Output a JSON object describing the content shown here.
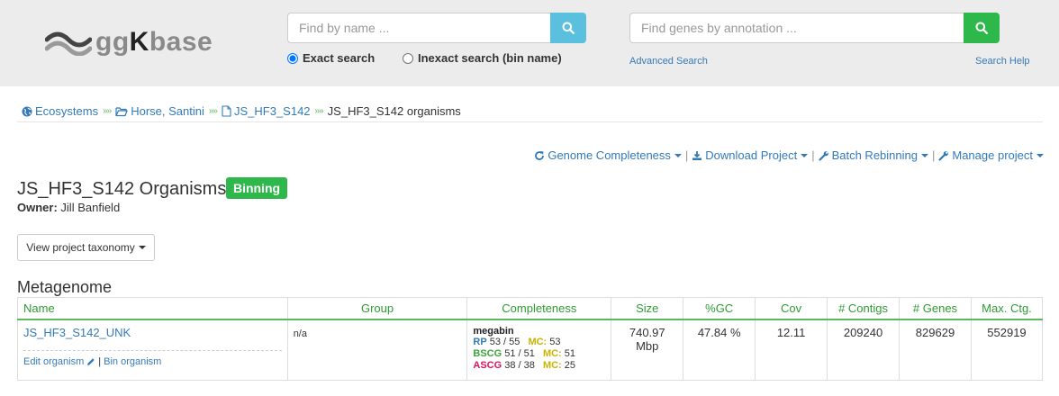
{
  "header": {
    "logo_prefix": "gg",
    "logo_k": "K",
    "logo_suffix": "base",
    "name_search": {
      "placeholder": "Find by name ..."
    },
    "annotation_search": {
      "placeholder": "Find genes by annotation ..."
    },
    "exact_label": "Exact search",
    "inexact_label": "Inexact search (bin name)",
    "exact_selected": true,
    "advanced_search": "Advanced Search",
    "search_help": "Search Help"
  },
  "breadcrumb": {
    "items": [
      "Ecosystems",
      "Horse, Santini",
      "JS_HF3_S142"
    ],
    "separator": "»»",
    "current": "JS_HF3_S142 organisms"
  },
  "actions": {
    "genome_completeness": "Genome Completeness",
    "download_project": "Download Project",
    "batch_rebinning": "Batch Rebinning",
    "manage_project": "Manage project"
  },
  "page": {
    "title": "JS_HF3_S142 Organisms",
    "badge": "Binning",
    "owner_label": "Owner:",
    "owner_name": "Jill Banfield",
    "taxonomy_button": "View project taxonomy"
  },
  "section": {
    "title": "Metagenome"
  },
  "table": {
    "columns": [
      "Name",
      "Group",
      "Completeness",
      "Size",
      "%GC",
      "Cov",
      "# Contigs",
      "# Genes",
      "Max. Ctg."
    ],
    "row": {
      "name": "JS_HF3_S142_UNK",
      "edit_link": "Edit organism",
      "bin_link": "Bin organism",
      "group": "n/a",
      "completeness": {
        "title": "megabin",
        "rp_label": "RP",
        "rp_value": "53 / 55",
        "rp_mc_label": "MC:",
        "rp_mc": "53",
        "bscg_label": "BSCG",
        "bscg_value": "51 / 51",
        "bscg_mc_label": "MC:",
        "bscg_mc": "51",
        "ascg_label": "ASCG",
        "ascg_value": "38 / 38",
        "ascg_mc_label": "MC:",
        "ascg_mc": "25"
      },
      "size_value": "740.97",
      "size_unit": "Mbp",
      "gc": "47.84 %",
      "cov": "12.11",
      "contigs": "209240",
      "genes": "829629",
      "max_ctg": "552919"
    }
  },
  "colors": {
    "brand_green": "#2eb84b",
    "link_blue": "#337ab7",
    "info_button": "#5bc0de",
    "header_bg": "#ececec"
  }
}
